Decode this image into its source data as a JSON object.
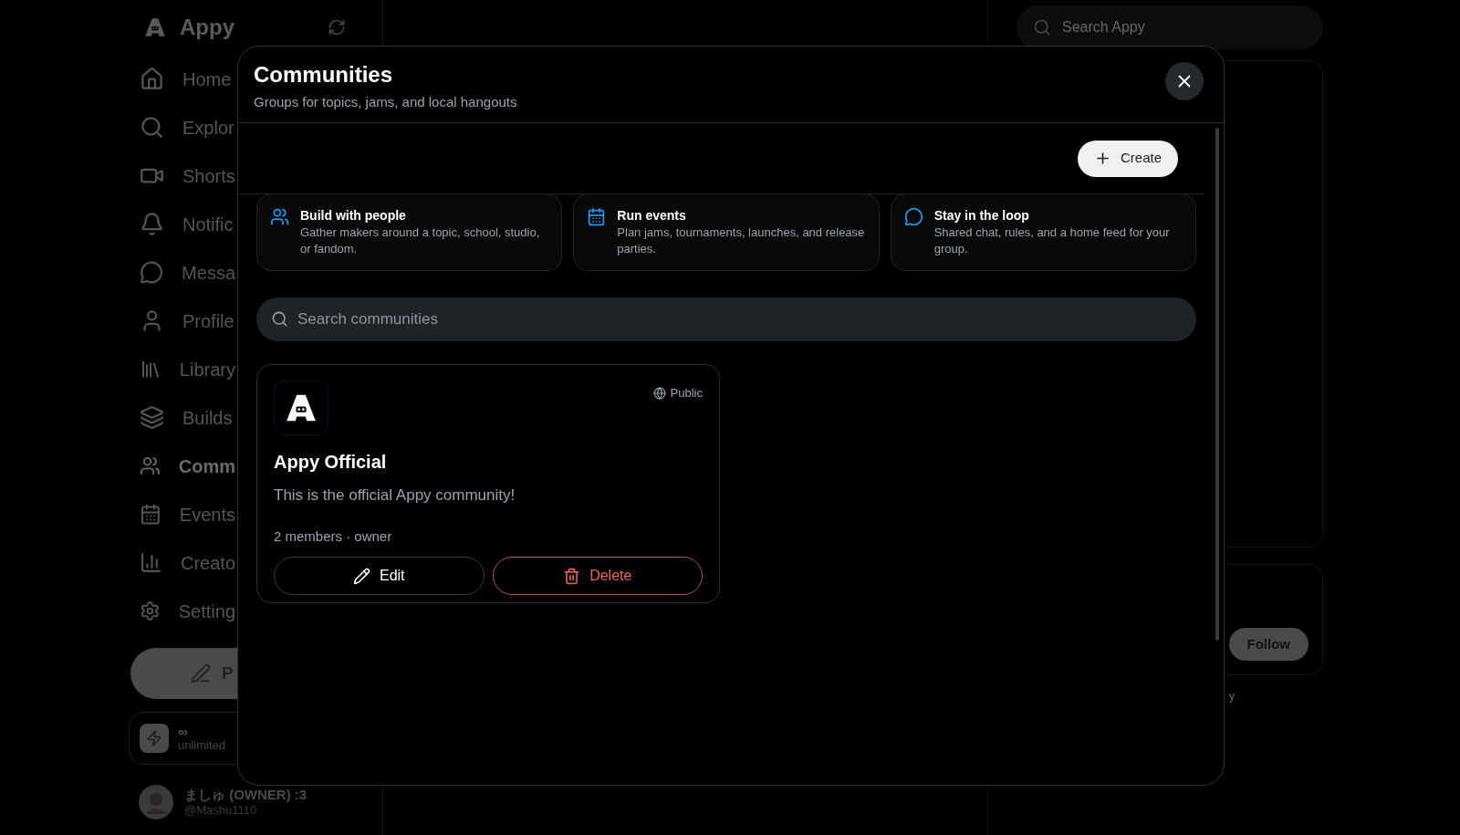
{
  "sidebar": {
    "brand": "Appy",
    "items": [
      {
        "kind": "home",
        "label": "Home",
        "selected": false
      },
      {
        "kind": "search",
        "label": "Explor",
        "selected": false
      },
      {
        "kind": "video",
        "label": "Shorts",
        "selected": false
      },
      {
        "kind": "bell",
        "label": "Notific",
        "selected": false
      },
      {
        "kind": "chat",
        "label": "Messa",
        "selected": false
      },
      {
        "kind": "user",
        "label": "Profile",
        "selected": false
      },
      {
        "kind": "library",
        "label": "Library",
        "selected": false
      },
      {
        "kind": "layers",
        "label": "Builds",
        "selected": false
      },
      {
        "kind": "users",
        "label": "Comm",
        "selected": true
      },
      {
        "kind": "calendar",
        "label": "Events",
        "selected": false
      },
      {
        "kind": "chart",
        "label": "Creato",
        "selected": false
      },
      {
        "kind": "gear",
        "label": "Setting",
        "selected": false
      }
    ],
    "post_button": "P",
    "credits": {
      "symbol": "∞",
      "label": "unlimited"
    },
    "account": {
      "name": "ましゅ (OWNER) :3",
      "handle": "@Mashu1110"
    }
  },
  "right_column": {
    "search": {
      "placeholder": "Search Appy"
    },
    "follow_button": "Follow",
    "footer_fragment": "y"
  },
  "dialog": {
    "title": "Communities",
    "subtitle": "Groups for topics, jams, and local hangouts",
    "create_button": "Create",
    "features": [
      {
        "kind": "users",
        "title": "Build with people",
        "text": "Gather makers around a topic, school, studio, or fandom."
      },
      {
        "kind": "calendar",
        "title": "Run events",
        "text": "Plan jams, tournaments, launches, and release parties."
      },
      {
        "kind": "chat",
        "title": "Stay in the loop",
        "text": "Shared chat, rules, and a home feed for your group."
      }
    ],
    "search": {
      "placeholder": "Search communities"
    },
    "communities": [
      {
        "name": "Appy Official",
        "visibility": "Public",
        "description": "This is the official Appy community!",
        "meta": "2 members · owner",
        "actions": [
          {
            "kind": "edit",
            "label": "Edit"
          },
          {
            "kind": "delete",
            "label": "Delete"
          }
        ]
      }
    ]
  }
}
